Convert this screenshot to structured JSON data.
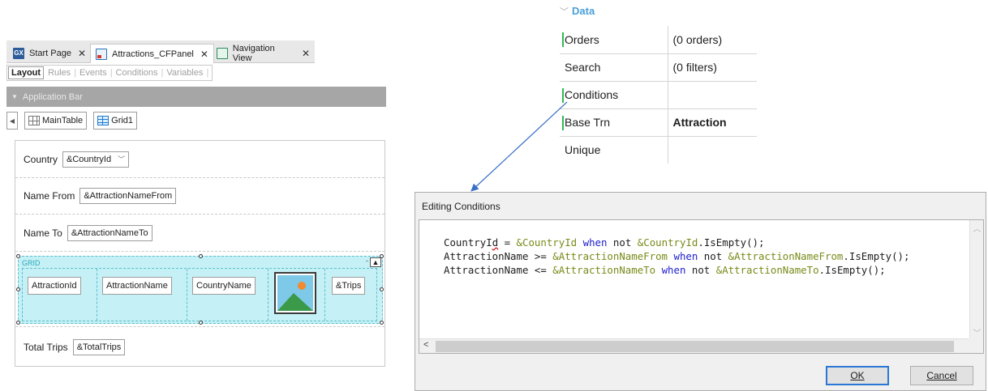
{
  "left_panel": {
    "tabs": [
      {
        "label": "Start Page",
        "icon": "gx-icon"
      },
      {
        "label": "Attractions_CFPanel",
        "icon": "panel-icon"
      },
      {
        "label": "Navigation View",
        "icon": "navigation-view-icon"
      }
    ],
    "subtabs": [
      "Layout",
      "Rules",
      "Events",
      "Conditions",
      "Variables"
    ],
    "app_bar": "Application Bar",
    "breadcrumbs": [
      "MainTable",
      "Grid1"
    ],
    "form": {
      "country_label": "Country",
      "country_value": "&CountryId",
      "name_from_label": "Name From",
      "name_from_value": "&AttractionNameFrom",
      "name_to_label": "Name To",
      "name_to_value": "&AttractionNameTo",
      "grid_caption": "GRID",
      "grid_columns": [
        "AttractionId",
        "AttractionName",
        "CountryName",
        "&Trips"
      ],
      "total_trips_label": "Total Trips",
      "total_trips_value": "&TotalTrips"
    }
  },
  "properties": {
    "section": "Data",
    "rows": [
      {
        "name": "Orders",
        "value": "(0 orders)"
      },
      {
        "name": "Search",
        "value": "(0 filters)"
      },
      {
        "name": "Conditions",
        "value": ""
      },
      {
        "name": "Base Trn",
        "value": "Attraction"
      },
      {
        "name": "Unique",
        "value": ""
      }
    ]
  },
  "dialog": {
    "title": "Editing Conditions",
    "code": [
      "CountryId = &CountryId when not &CountryId.IsEmpty();",
      "AttractionName >= &AttractionNameFrom when not &AttractionNameFrom.IsEmpty();",
      "AttractionName <= &AttractionNameTo when not &AttractionNameTo.IsEmpty();"
    ],
    "ok_label": "OK",
    "cancel_label": "Cancel"
  },
  "colors": {
    "accent_blue": "#4aa0d9",
    "green_marker": "#2dbb55",
    "grid_fill": "#c5f0f5",
    "keyword": "#1c1ccf",
    "variable": "#7a8a1a"
  }
}
